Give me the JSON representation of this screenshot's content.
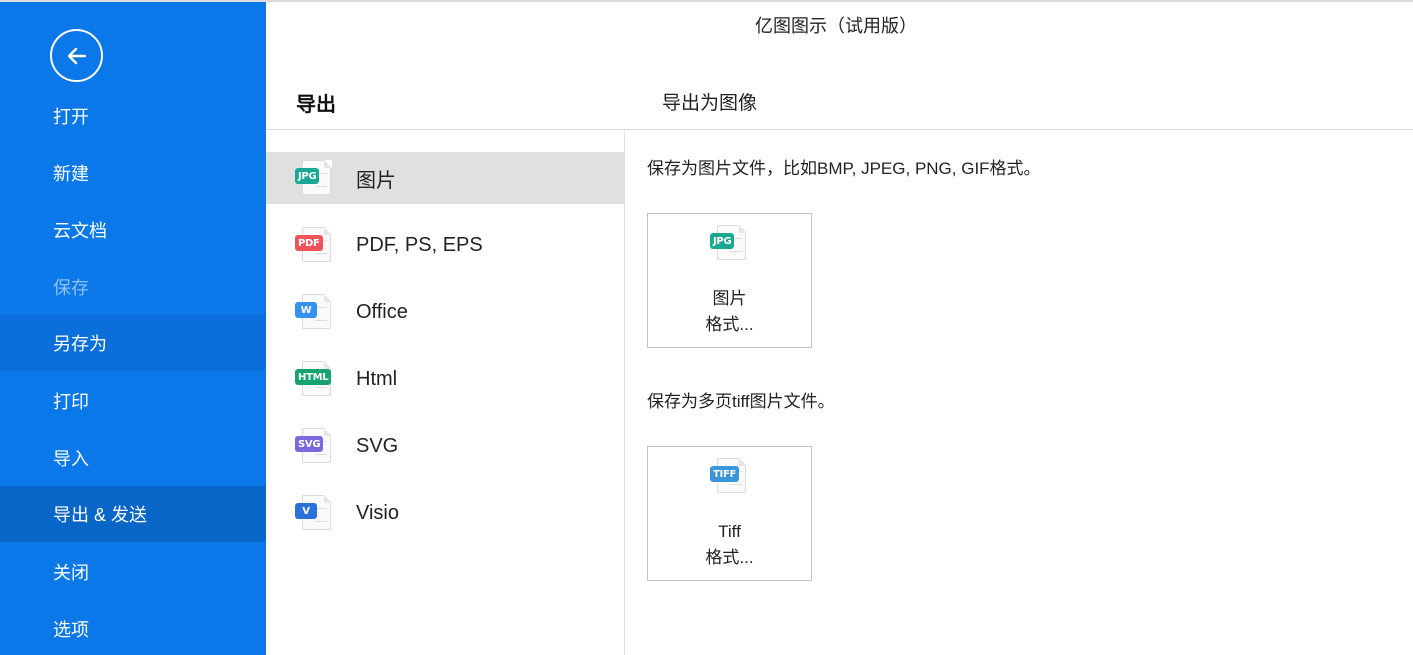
{
  "window": {
    "title": "亿图图示（试用版）"
  },
  "sidebar": {
    "back_icon": "back-arrow-circle-icon",
    "items": [
      {
        "label": "打开",
        "state": "normal"
      },
      {
        "label": "新建",
        "state": "normal"
      },
      {
        "label": "云文档",
        "state": "normal"
      },
      {
        "label": "保存",
        "state": "disabled"
      },
      {
        "label": "另存为",
        "state": "hover"
      },
      {
        "label": "打印",
        "state": "normal"
      },
      {
        "label": "导入",
        "state": "normal"
      },
      {
        "label": "导出 & 发送",
        "state": "active"
      },
      {
        "label": "关闭",
        "state": "normal"
      },
      {
        "label": "选项",
        "state": "normal"
      }
    ],
    "colors": {
      "background": "#0A78E8",
      "hover": "#0A6FDB",
      "active": "#0866C8"
    }
  },
  "export": {
    "heading": "导出",
    "formats": [
      {
        "label": "图片",
        "badge": "JPG",
        "color": "#1AA894",
        "icon": "jpg-file-icon",
        "selected": true
      },
      {
        "label": "PDF, PS, EPS",
        "badge": "PDF",
        "color": "#F0545A",
        "icon": "pdf-file-icon",
        "selected": false
      },
      {
        "label": "Office",
        "badge": "W",
        "color": "#3592F0",
        "icon": "word-file-icon",
        "selected": false
      },
      {
        "label": "Html",
        "badge": "HTML",
        "color": "#17A36E",
        "icon": "html-file-icon",
        "selected": false
      },
      {
        "label": "SVG",
        "badge": "SVG",
        "color": "#7B68DD",
        "icon": "svg-file-icon",
        "selected": false
      },
      {
        "label": "Visio",
        "badge": "V",
        "color": "#2A72DA",
        "icon": "visio-file-icon",
        "selected": false
      }
    ]
  },
  "detail": {
    "heading": "导出为图像",
    "sections": [
      {
        "description": "保存为图片文件，比如BMP, JPEG, PNG, GIF格式。",
        "card": {
          "line1": "图片",
          "line2": "格式...",
          "badge": "JPG",
          "color": "#1AA894",
          "icon": "jpg-file-icon"
        }
      },
      {
        "description": "保存为多页tiff图片文件。",
        "card": {
          "line1": "Tiff",
          "line2": "格式...",
          "badge": "TIFF",
          "color": "#3B95DA",
          "icon": "tiff-file-icon"
        }
      }
    ]
  }
}
